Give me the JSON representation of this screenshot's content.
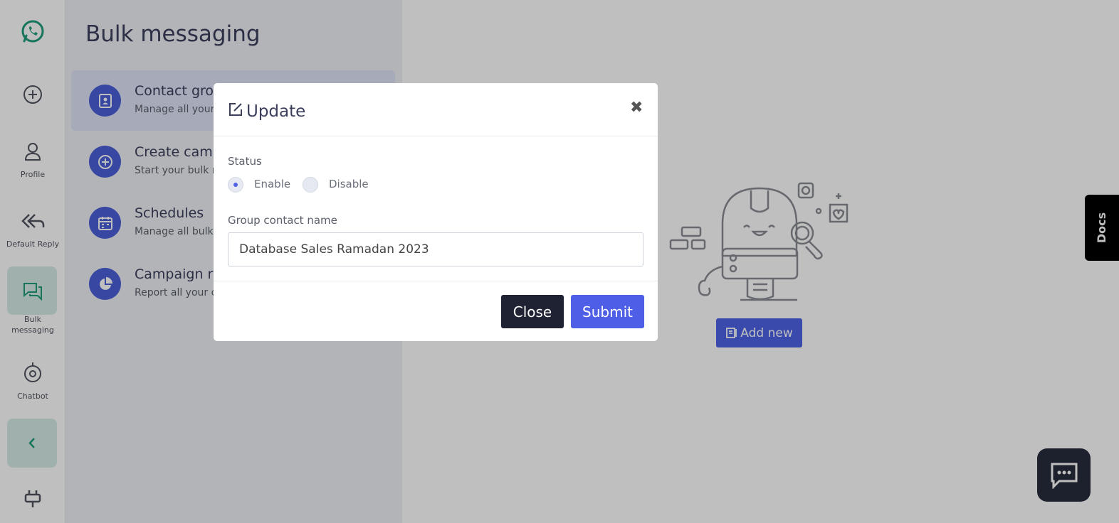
{
  "rail": {
    "items": [
      {
        "label": ""
      },
      {
        "label": ""
      },
      {
        "label": "Profile"
      },
      {
        "label": "Default Reply"
      },
      {
        "label": "Bulk messaging"
      },
      {
        "label": "Chatbot"
      },
      {
        "label": ""
      },
      {
        "label": ""
      }
    ]
  },
  "panel": {
    "title": "Bulk messaging",
    "items": [
      {
        "title": "Contact gro",
        "desc": "Manage all your"
      },
      {
        "title": "Create cam",
        "desc": "Start your bulk m"
      },
      {
        "title": "Schedules",
        "desc": "Manage all bulk"
      },
      {
        "title": "Campaign r",
        "desc": "Report all your c"
      }
    ]
  },
  "main": {
    "add_new_label": "Add new",
    "docs_label": "Docs"
  },
  "modal": {
    "title": "Update",
    "status_label": "Status",
    "enable_label": "Enable",
    "disable_label": "Disable",
    "status_value": "Enable",
    "group_name_label": "Group contact name",
    "group_name_value": "Database Sales Ramadan 2023",
    "close_label": "Close",
    "submit_label": "Submit"
  },
  "colors": {
    "accent": "#4e63e6",
    "brand_green": "#1f9c7a",
    "dark": "#1f2233"
  }
}
